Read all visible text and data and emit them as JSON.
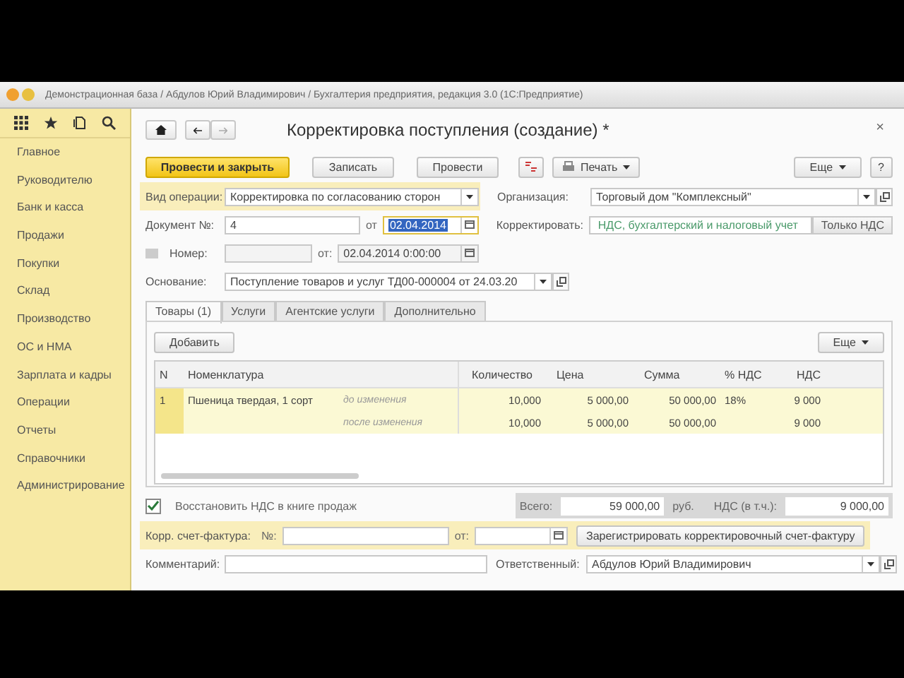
{
  "window": {
    "title": "Демонстрационная база / Абдулов Юрий Владимирович / Бухгалтерия предприятия, редакция 3.0 (1С:Предприятие)"
  },
  "sidebar": {
    "items": [
      {
        "label": "Главное"
      },
      {
        "label": "Руководителю"
      },
      {
        "label": "Банк и касса"
      },
      {
        "label": "Продажи"
      },
      {
        "label": "Покупки"
      },
      {
        "label": "Склад"
      },
      {
        "label": "Производство"
      },
      {
        "label": "ОС и НМА"
      },
      {
        "label": "Зарплата и кадры"
      },
      {
        "label": "Операции"
      },
      {
        "label": "Отчеты"
      },
      {
        "label": "Справочники"
      },
      {
        "label": "Администрирование"
      }
    ]
  },
  "form": {
    "title": "Корректировка поступления (создание) *",
    "close": "×"
  },
  "toolbar": {
    "buttons": [
      {
        "label": "Провести и закрыть",
        "kind": "primary"
      },
      {
        "label": "Записать",
        "kind": "normal"
      },
      {
        "label": "Провести",
        "kind": "normal"
      }
    ],
    "print": "Печать",
    "more": "Еще",
    "help": "?"
  },
  "operation": {
    "label": "Вид операции:",
    "value": "Корректировка по согласованию сторон"
  },
  "organization": {
    "label": "Организация:",
    "value": "Торговый дом \"Комплексный\""
  },
  "document": {
    "label": "Документ №:",
    "value": "4",
    "date_label": "от",
    "date": "02.04.2014"
  },
  "correct": {
    "label": "Корректировать:",
    "options": [
      {
        "label": "НДС, бухгалтерский и налоговый учет",
        "selected": true
      },
      {
        "label": "Только НДС",
        "selected": false
      }
    ]
  },
  "number": {
    "label": "Номер:",
    "date_label": "от:",
    "date": "02.04.2014  0:00:00"
  },
  "basis": {
    "label": "Основание:",
    "value": "Поступление товаров и услуг ТД00-000004 от 24.03.20"
  },
  "tabs": [
    {
      "label": "Товары (1)",
      "selected": true
    },
    {
      "label": "Услуги",
      "selected": false
    },
    {
      "label": "Агентские услуги",
      "selected": false
    },
    {
      "label": "Дополнительно",
      "selected": false
    }
  ],
  "table": {
    "add": "Добавить",
    "more": "Еще",
    "columns": [
      "N",
      "Номенклатура",
      "Количество",
      "Цена",
      "Сумма",
      "% НДС",
      "НДС"
    ],
    "rows": [
      {
        "n": "1",
        "name": "Пшеница твердая, 1 сорт",
        "stage": "до изменения",
        "qty": "10,000",
        "price": "5 000,00",
        "sum": "50 000,00",
        "rate": "18%",
        "vat": "9 000"
      },
      {
        "stage": "после изменения",
        "qty": "10,000",
        "price": "5 000,00",
        "sum": "50 000,00",
        "vat": "9 000"
      }
    ]
  },
  "restore_vat": {
    "label": "Восстановить НДС в книге продаж",
    "checked": true
  },
  "totals": {
    "total_label": "Всего:",
    "total": "59 000,00",
    "currency": "руб.",
    "vat_label": "НДС (в т.ч.):",
    "vat": "9 000,00"
  },
  "invoice": {
    "label": "Корр. счет-фактура:",
    "number_label": "№:",
    "date_label": "от:",
    "register": "Зарегистрировать корректировочный счет-фактуру"
  },
  "comment": {
    "label": "Комментарий:"
  },
  "responsible": {
    "label": "Ответственный:",
    "value": "Абдулов Юрий Владимирович"
  }
}
